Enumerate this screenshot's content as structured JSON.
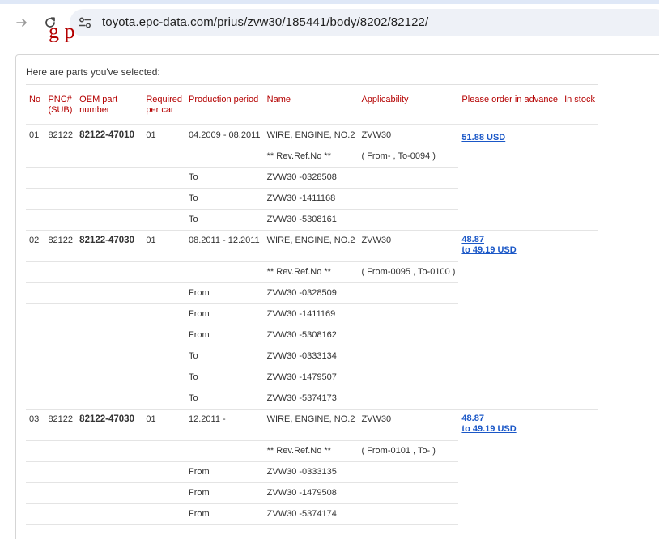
{
  "browser": {
    "url": "toyota.epc-data.com/prius/zvw30/185441/body/8202/82122/"
  },
  "page": {
    "heading": "g  p",
    "intro": "Here are parts you've selected:"
  },
  "table": {
    "headers": {
      "no": "No",
      "pnc": "PNC# (SUB)",
      "oem": "OEM part number",
      "req": "Required per car",
      "period": "Production period",
      "name": "Name",
      "applicability": "Applicability",
      "order": "Please order in advance",
      "stock": "In stock"
    },
    "parts": [
      {
        "no": "01",
        "pnc": "82122",
        "oem": "82122-47010",
        "req": "01",
        "period": "04.2009 - 08.2011",
        "name": "WIRE, ENGINE, NO.2",
        "applicability": "ZVW30",
        "price_line1": "51.88 USD",
        "price_line2": "",
        "rev_ref": "** Rev.Ref.No **",
        "rev_range": "( From- , To-0094 )",
        "vins": [
          {
            "dir": "To",
            "vin": "ZVW30 -0328508"
          },
          {
            "dir": "To",
            "vin": "ZVW30 -1411168"
          },
          {
            "dir": "To",
            "vin": "ZVW30 -5308161"
          }
        ]
      },
      {
        "no": "02",
        "pnc": "82122",
        "oem": "82122-47030",
        "req": "01",
        "period": "08.2011 - 12.2011",
        "name": "WIRE, ENGINE, NO.2",
        "applicability": "ZVW30",
        "price_line1": "48.87",
        "price_line2": "to 49.19 USD",
        "rev_ref": "** Rev.Ref.No **",
        "rev_range": "( From-0095 , To-0100 )",
        "vins": [
          {
            "dir": "From",
            "vin": "ZVW30 -0328509"
          },
          {
            "dir": "From",
            "vin": "ZVW30 -1411169"
          },
          {
            "dir": "From",
            "vin": "ZVW30 -5308162"
          },
          {
            "dir": "To",
            "vin": "ZVW30 -0333134"
          },
          {
            "dir": "To",
            "vin": "ZVW30 -1479507"
          },
          {
            "dir": "To",
            "vin": "ZVW30 -5374173"
          }
        ]
      },
      {
        "no": "03",
        "pnc": "82122",
        "oem": "82122-47030",
        "req": "01",
        "period": "12.2011 -",
        "name": "WIRE, ENGINE, NO.2",
        "applicability": "ZVW30",
        "price_line1": "48.87",
        "price_line2": "to 49.19 USD",
        "rev_ref": "** Rev.Ref.No **",
        "rev_range": "( From-0101 , To- )",
        "vins": [
          {
            "dir": "From",
            "vin": "ZVW30 -0333135"
          },
          {
            "dir": "From",
            "vin": "ZVW30 -1479508"
          },
          {
            "dir": "From",
            "vin": "ZVW30 -5374174"
          }
        ]
      }
    ]
  },
  "colors": {
    "header_red": "#b40000",
    "link_blue": "#1a57c7"
  }
}
